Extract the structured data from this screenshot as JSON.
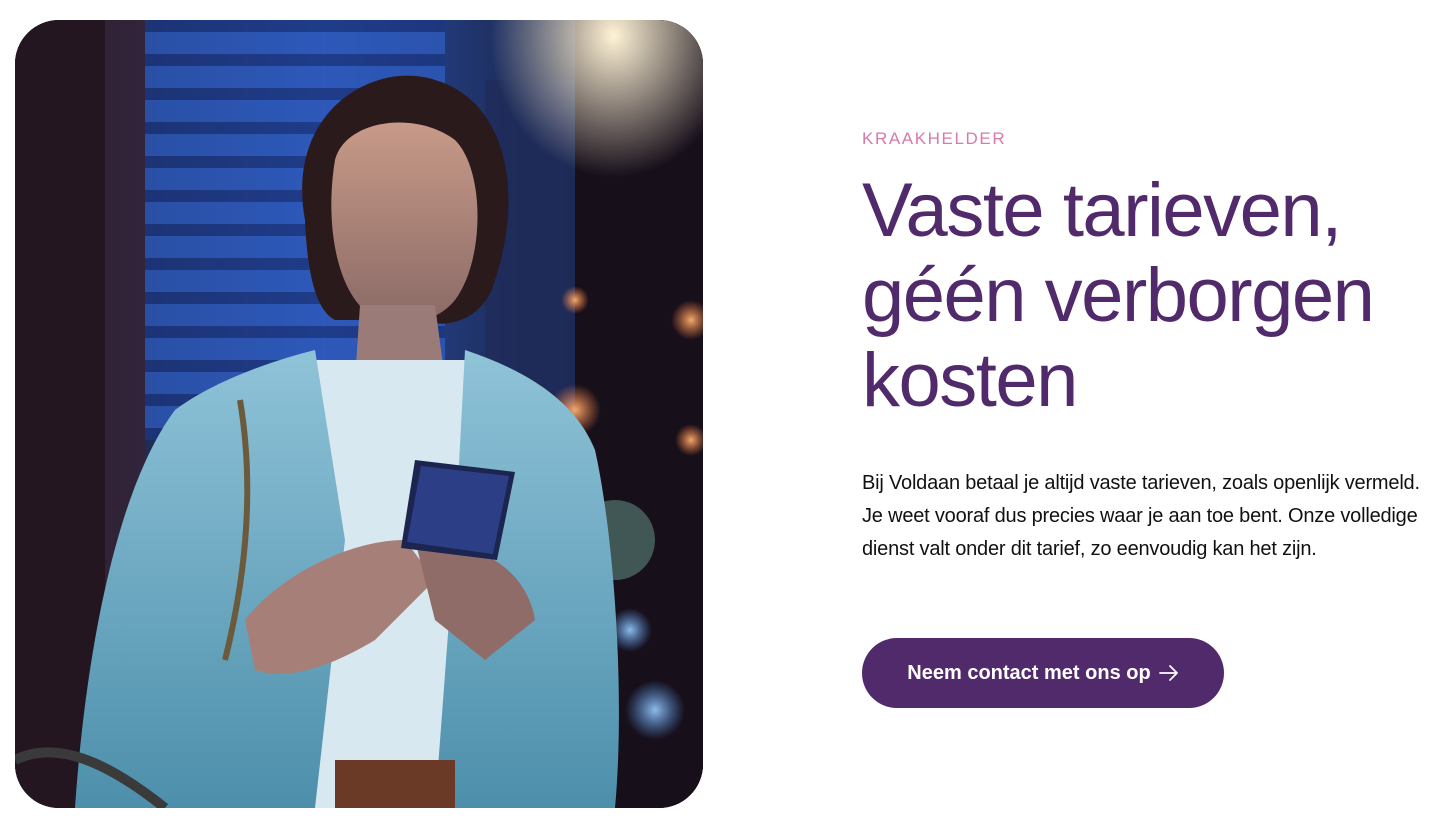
{
  "hero": {
    "image_alt": "Vrouw met smartphone in de stad bij nacht",
    "eyebrow": "KRAAKHELDER",
    "headline_lines": [
      "Vaste tarieven,",
      "géén verborgen",
      "kosten"
    ],
    "body": "Bij Voldaan betaal je altijd vaste tarieven, zoals openlijk vermeld. Je weet vooraf dus precies waar je aan toe bent. Onze volledige dienst valt onder dit tarief, zo eenvoudig kan het zijn.",
    "cta_label": "Neem contact met ons op",
    "cta_icon": "arrow-right-icon"
  },
  "colors": {
    "brand_purple": "#512a6b",
    "eyebrow_pink": "#d77aac",
    "body_text": "#111111",
    "background": "#ffffff"
  }
}
